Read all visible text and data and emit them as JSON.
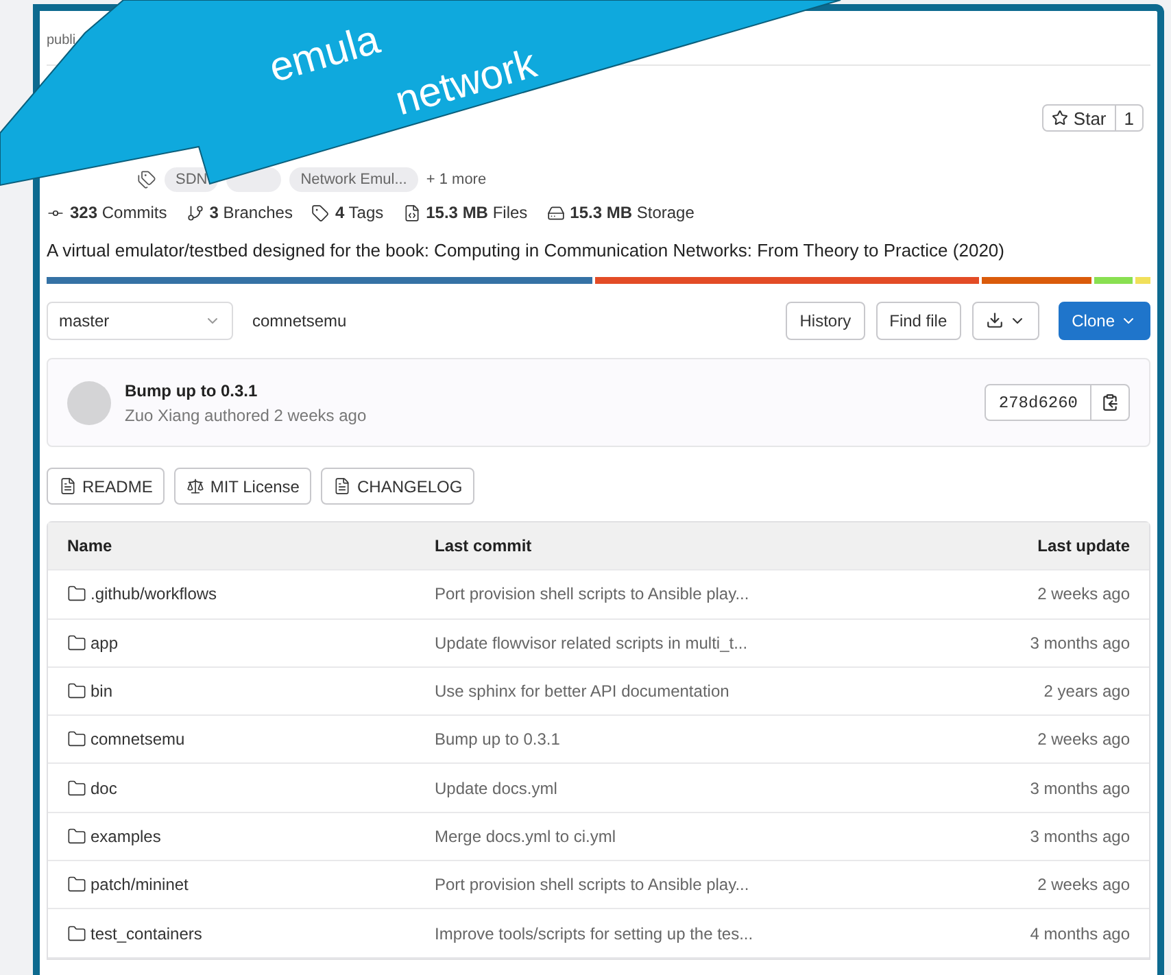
{
  "callout": {
    "lines": [
      "emula",
      "network"
    ]
  },
  "header": {
    "visibility": "publi"
  },
  "star": {
    "label": "Star",
    "count": "1"
  },
  "topics": [
    {
      "label": "SDN"
    },
    {
      "label": "Network Emul..."
    }
  ],
  "topics_more": "+ 1 more",
  "stats": [
    {
      "kind": "commit",
      "value": "323",
      "label": "Commits"
    },
    {
      "kind": "branch",
      "value": "3",
      "label": "Branches"
    },
    {
      "kind": "tag",
      "value": "4",
      "label": "Tags"
    },
    {
      "kind": "file",
      "value": "15.3 MB",
      "label": "Files"
    },
    {
      "kind": "storage",
      "value": "15.3 MB",
      "label": "Storage"
    }
  ],
  "description": "A virtual emulator/testbed designed for the book: Computing in Communication Networks: From Theory to Practice (2020)",
  "languages": [
    {
      "color": "#3572a5"
    },
    {
      "color": "#e34c26"
    },
    {
      "color": "#da5b0b"
    },
    {
      "color": "#89e051"
    },
    {
      "color": "#f1e05a"
    }
  ],
  "toolbar": {
    "branch": "master",
    "path": "comnetsemu",
    "buttons": [
      "History",
      "Find file"
    ],
    "clone": "Clone"
  },
  "last_commit": {
    "title": "Bump up to 0.3.1",
    "author": "Zuo Xiang",
    "meta": "authored 2 weeks ago",
    "sha": "278d6260"
  },
  "doc_buttons": [
    {
      "kind": "file",
      "label": "README"
    },
    {
      "kind": "license",
      "label": "MIT License"
    },
    {
      "kind": "file",
      "label": "CHANGELOG"
    }
  ],
  "table": {
    "columns": [
      "Name",
      "Last commit",
      "Last update"
    ],
    "rows": [
      {
        "name": ".github/workflows",
        "commit": "Port provision shell scripts to Ansible play...",
        "updated": "2 weeks ago"
      },
      {
        "name": "app",
        "commit": "Update flowvisor related scripts in multi_t...",
        "updated": "3 months ago"
      },
      {
        "name": "bin",
        "commit": "Use sphinx for better API documentation",
        "updated": "2 years ago"
      },
      {
        "name": "comnetsemu",
        "commit": "Bump up to 0.3.1",
        "updated": "2 weeks ago"
      },
      {
        "name": "doc",
        "commit": "Update docs.yml",
        "updated": "3 months ago"
      },
      {
        "name": "examples",
        "commit": "Merge docs.yml to ci.yml",
        "updated": "3 months ago"
      },
      {
        "name": "patch/mininet",
        "commit": "Port provision shell scripts to Ansible play...",
        "updated": "2 weeks ago"
      },
      {
        "name": "test_containers",
        "commit": "Improve tools/scripts for setting up the tes...",
        "updated": "4 months ago"
      }
    ]
  }
}
